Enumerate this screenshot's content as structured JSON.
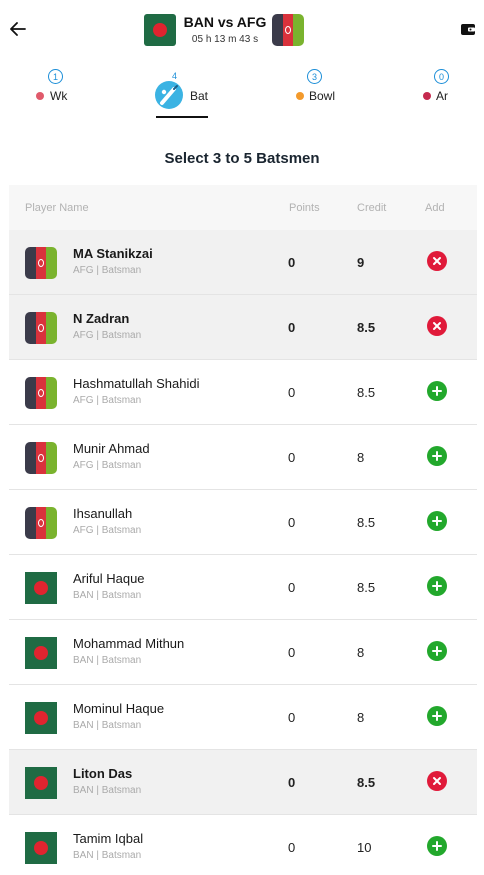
{
  "header": {
    "title": "BAN vs AFG",
    "timer": "05 h 13 m 43 s"
  },
  "tabs": [
    {
      "count": "1",
      "label": "Wk",
      "dot_color": "#e05a6b"
    },
    {
      "count": "4",
      "label": "Bat",
      "active": true
    },
    {
      "count": "3",
      "label": "Bowl",
      "dot_color": "#f39a2c"
    },
    {
      "count": "0",
      "label": "Ar",
      "dot_color": "#c52a4e"
    }
  ],
  "section_title": "Select 3 to 5 Batsmen",
  "table": {
    "headers": {
      "name": "Player Name",
      "points": "Points",
      "credit": "Credit",
      "add": "Add"
    },
    "rows": [
      {
        "name": "MA Stanikzai",
        "meta": "AFG | Batsman",
        "points": "0",
        "credit": "9",
        "team": "AFG",
        "selected": true,
        "action": "remove"
      },
      {
        "name": "N Zadran",
        "meta": "AFG | Batsman",
        "points": "0",
        "credit": "8.5",
        "team": "AFG",
        "selected": true,
        "action": "remove"
      },
      {
        "name": "Hashmatullah Shahidi",
        "meta": "AFG | Batsman",
        "points": "0",
        "credit": "8.5",
        "team": "AFG",
        "selected": false,
        "action": "add"
      },
      {
        "name": "Munir Ahmad",
        "meta": "AFG | Batsman",
        "points": "0",
        "credit": "8",
        "team": "AFG",
        "selected": false,
        "action": "add"
      },
      {
        "name": "Ihsanullah",
        "meta": "AFG | Batsman",
        "points": "0",
        "credit": "8.5",
        "team": "AFG",
        "selected": false,
        "action": "add"
      },
      {
        "name": "Ariful Haque",
        "meta": "BAN | Batsman",
        "points": "0",
        "credit": "8.5",
        "team": "BAN",
        "selected": false,
        "action": "add"
      },
      {
        "name": "Mohammad Mithun",
        "meta": "BAN | Batsman",
        "points": "0",
        "credit": "8",
        "team": "BAN",
        "selected": false,
        "action": "add"
      },
      {
        "name": "Mominul Haque",
        "meta": "BAN | Batsman",
        "points": "0",
        "credit": "8",
        "team": "BAN",
        "selected": false,
        "action": "add"
      },
      {
        "name": "Liton Das",
        "meta": "BAN | Batsman",
        "points": "0",
        "credit": "8.5",
        "team": "BAN",
        "selected": true,
        "action": "remove"
      },
      {
        "name": "Tamim Iqbal",
        "meta": "BAN | Batsman",
        "points": "0",
        "credit": "10",
        "team": "BAN",
        "selected": false,
        "action": "add"
      }
    ]
  },
  "colors": {
    "accent": "#1d8fd8",
    "add_green": "#22a82c",
    "remove_red": "#e01a3a",
    "ban_green": "#1f6b44",
    "ban_red": "#e0242f",
    "afg_dark": "#3b3b4a",
    "afg_red": "#d9323c",
    "afg_green": "#7ab32e"
  },
  "icons": {
    "back": "arrow-left-icon",
    "wallet": "wallet-icon",
    "bat": "cricket-bat-icon",
    "add": "plus-circle-icon",
    "remove": "x-circle-icon"
  }
}
